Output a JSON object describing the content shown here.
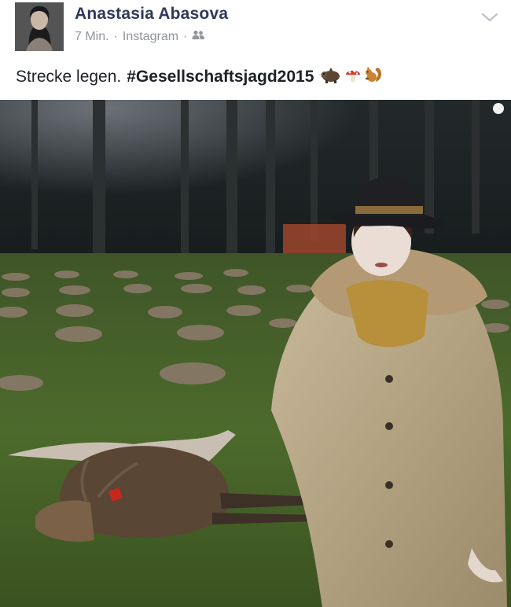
{
  "post": {
    "author": "Anastasia Abasova",
    "time": "7 Min.",
    "separator": "·",
    "source": "Instagram",
    "separator2": "·",
    "audience_icon": "friends-icon",
    "menu_icon": "chevron-down-icon",
    "text_plain": "Strecke legen.",
    "hashtag": "#Gesellschaftsjagd2015",
    "emoji_icons": [
      "boar-icon",
      "mushroom-icon",
      "squirrel-icon"
    ]
  },
  "photo": {
    "description_icon": "hunting-photo"
  },
  "colors": {
    "author_name": "#2d3a5a",
    "meta_text": "#90949c",
    "body_text": "#1d2129"
  }
}
